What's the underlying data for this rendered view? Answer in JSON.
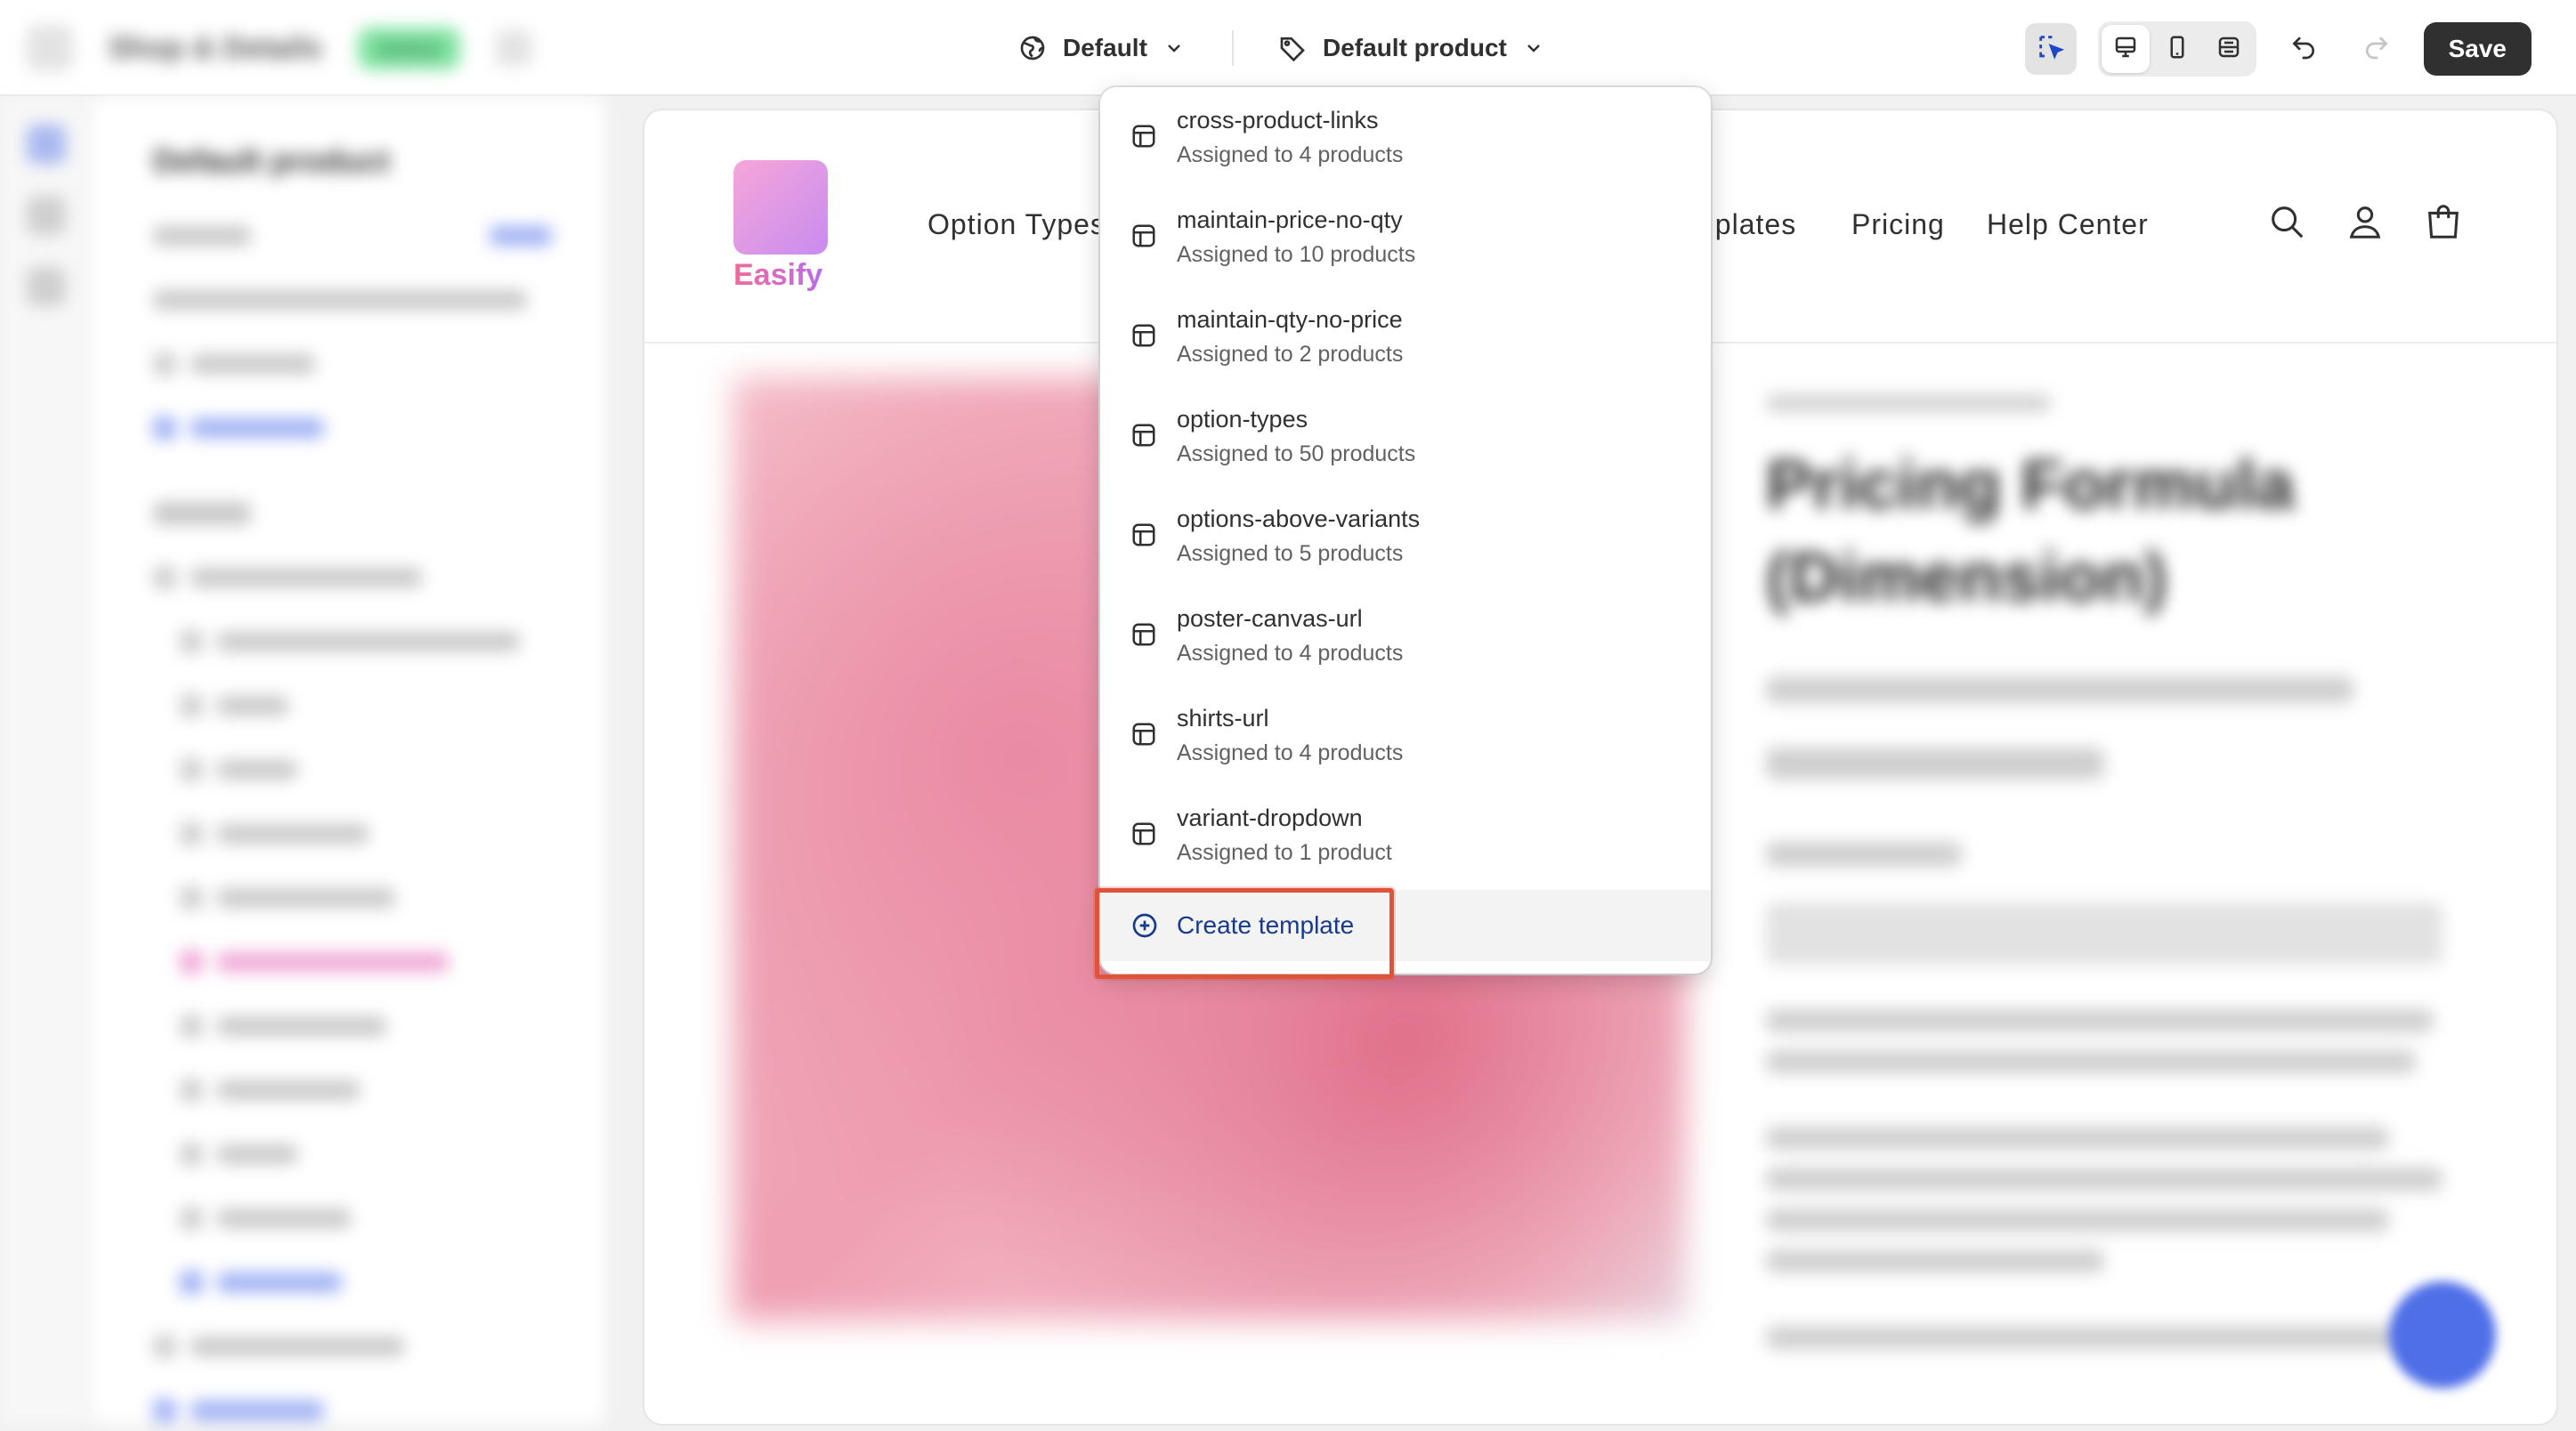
{
  "topbar": {
    "store_name": "Shop & Details",
    "status_badge": "Active",
    "theme_selector": "Default",
    "template_selector": "Default product",
    "save_label": "Save"
  },
  "sidebar": {
    "title": "Default product"
  },
  "storefront": {
    "logo_text": "Easify",
    "nav": [
      "Option Types",
      "nplates",
      "Pricing",
      "Help Center"
    ],
    "product_title": "Pricing Formula (Dimension)"
  },
  "template_dropdown": {
    "items": [
      {
        "name": "cross-product-links",
        "assigned": "Assigned to 4 products"
      },
      {
        "name": "maintain-price-no-qty",
        "assigned": "Assigned to 10 products"
      },
      {
        "name": "maintain-qty-no-price",
        "assigned": "Assigned to 2 products"
      },
      {
        "name": "option-types",
        "assigned": "Assigned to 50 products"
      },
      {
        "name": "options-above-variants",
        "assigned": "Assigned to 5 products"
      },
      {
        "name": "poster-canvas-url",
        "assigned": "Assigned to 4 products"
      },
      {
        "name": "shirts-url",
        "assigned": "Assigned to 4 products"
      },
      {
        "name": "variant-dropdown",
        "assigned": "Assigned to 1 product"
      }
    ],
    "create_label": "Create template"
  },
  "colors": {
    "accent_highlight": "#e0533b",
    "create_link": "#183a8c",
    "save_button": "#303030"
  }
}
